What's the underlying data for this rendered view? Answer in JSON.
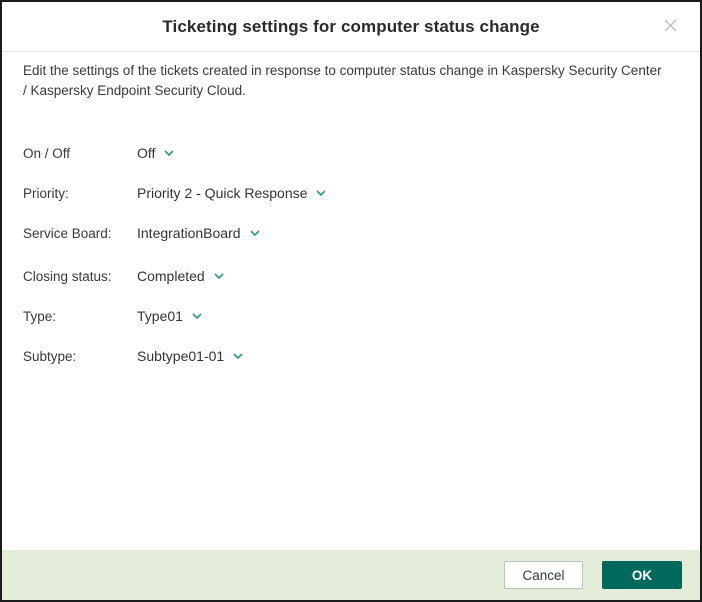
{
  "dialog": {
    "title": "Ticketing settings for computer status change",
    "description": "Edit the settings of the tickets created in response to computer status change in Kaspersky Security Center / Kaspersky Endpoint Security Cloud."
  },
  "form": {
    "fields": [
      {
        "label": "On / Off",
        "value": "Off"
      },
      {
        "label": "Priority:",
        "value": "Priority 2 - Quick Response"
      },
      {
        "label": "Service Board:",
        "value": "IntegrationBoard"
      },
      {
        "label": "Closing status:",
        "value": "Completed"
      },
      {
        "label": "Type:",
        "value": "Type01"
      },
      {
        "label": "Subtype:",
        "value": "Subtype01-01"
      }
    ]
  },
  "footer": {
    "cancel_label": "Cancel",
    "ok_label": "OK"
  },
  "icons": {
    "close": "close-icon",
    "chevron": "chevron-down-icon"
  },
  "colors": {
    "ok_button_bg": "#00695c",
    "footer_bg": "#e3edda",
    "chevron_green": "#2a9d78",
    "border_dark": "#1b1b1b"
  }
}
